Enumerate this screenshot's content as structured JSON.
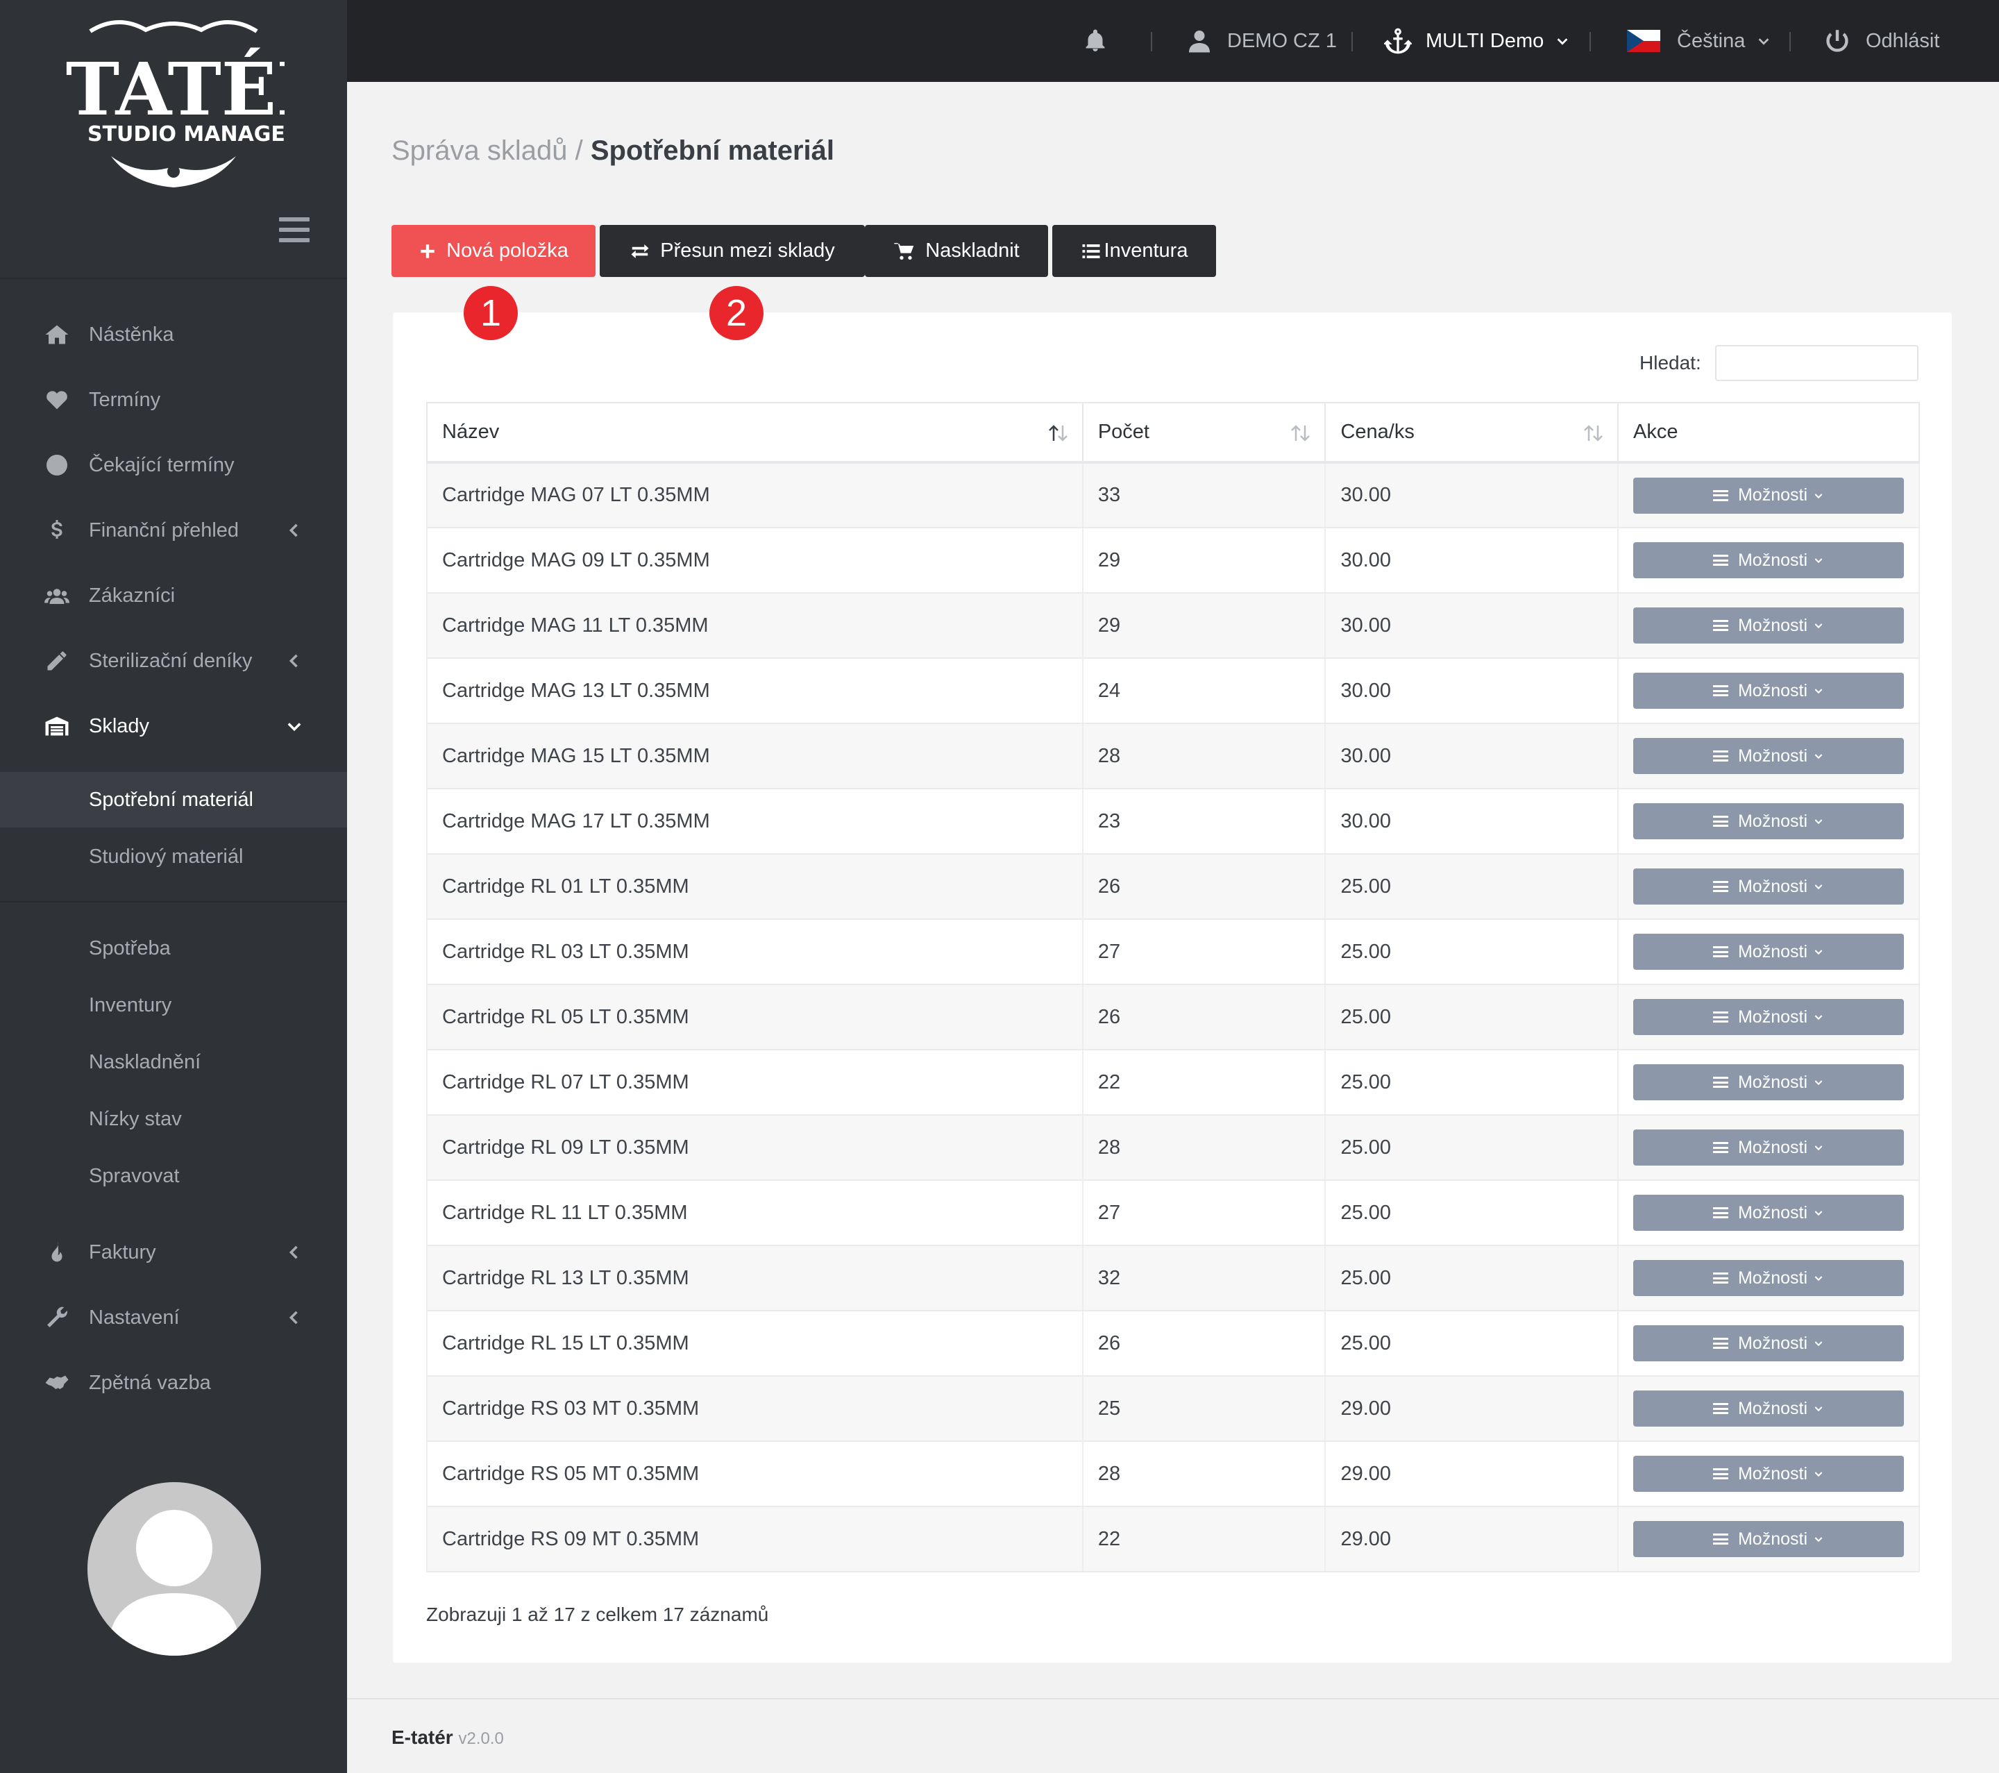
{
  "app": {
    "logo_text": "ETATÉR",
    "logo_sub": "STUDIO MANAGER"
  },
  "topbar": {
    "user": "DEMO CZ 1",
    "studio": "MULTI Demo",
    "language": "Čeština",
    "logout": "Odhlásit"
  },
  "sidebar": {
    "items": [
      {
        "label": "Nástěnka",
        "icon": "home-icon"
      },
      {
        "label": "Termíny",
        "icon": "heart-icon"
      },
      {
        "label": "Čekající termíny",
        "icon": "clock-icon"
      },
      {
        "label": "Finanční přehled",
        "icon": "dollar-icon"
      },
      {
        "label": "Zákazníci",
        "icon": "users-icon"
      },
      {
        "label": "Sterilizační deníky",
        "icon": "pencil-icon"
      },
      {
        "label": "Sklady",
        "icon": "warehouse-icon"
      },
      {
        "label": "Faktury",
        "icon": "fire-icon"
      },
      {
        "label": "Nastavení",
        "icon": "wrench-icon"
      },
      {
        "label": "Zpětná vazba",
        "icon": "handshake-icon"
      }
    ],
    "sub_items": [
      {
        "label": "Spotřební materiál"
      },
      {
        "label": "Studiový materiál"
      },
      {
        "label": "Spotřeba"
      },
      {
        "label": "Inventury"
      },
      {
        "label": "Naskladnění"
      },
      {
        "label": "Nízky stav"
      },
      {
        "label": "Spravovat"
      }
    ]
  },
  "breadcrumb": {
    "parent": "Správa skladů /",
    "current": "Spotřební materiál"
  },
  "toolbar": {
    "new_item": "Nová položka",
    "transfer": "Přesun mezi sklady",
    "restock": "Naskladnit",
    "inventory": "Inventura"
  },
  "markers": [
    "1",
    "2"
  ],
  "search": {
    "label": "Hledat:",
    "value": ""
  },
  "table": {
    "columns": [
      "Název",
      "Počet",
      "Cena/ks",
      "Akce"
    ],
    "action_label": "Možnosti",
    "rows": [
      {
        "name": "Cartridge MAG 07 LT 0.35MM",
        "count": "33",
        "price": "30.00"
      },
      {
        "name": "Cartridge MAG 09 LT 0.35MM",
        "count": "29",
        "price": "30.00"
      },
      {
        "name": "Cartridge MAG 11 LT 0.35MM",
        "count": "29",
        "price": "30.00"
      },
      {
        "name": "Cartridge MAG 13 LT 0.35MM",
        "count": "24",
        "price": "30.00"
      },
      {
        "name": "Cartridge MAG 15 LT 0.35MM",
        "count": "28",
        "price": "30.00"
      },
      {
        "name": "Cartridge MAG 17 LT 0.35MM",
        "count": "23",
        "price": "30.00"
      },
      {
        "name": "Cartridge RL 01 LT 0.35MM",
        "count": "26",
        "price": "25.00"
      },
      {
        "name": "Cartridge RL 03 LT 0.35MM",
        "count": "27",
        "price": "25.00"
      },
      {
        "name": "Cartridge RL 05 LT 0.35MM",
        "count": "26",
        "price": "25.00"
      },
      {
        "name": "Cartridge RL 07 LT 0.35MM",
        "count": "22",
        "price": "25.00"
      },
      {
        "name": "Cartridge RL 09 LT 0.35MM",
        "count": "28",
        "price": "25.00"
      },
      {
        "name": "Cartridge RL 11 LT 0.35MM",
        "count": "27",
        "price": "25.00"
      },
      {
        "name": "Cartridge RL 13 LT 0.35MM",
        "count": "32",
        "price": "25.00"
      },
      {
        "name": "Cartridge RL 15 LT 0.35MM",
        "count": "26",
        "price": "25.00"
      },
      {
        "name": "Cartridge RS 03 MT 0.35MM",
        "count": "25",
        "price": "29.00"
      },
      {
        "name": "Cartridge RS 05 MT 0.35MM",
        "count": "28",
        "price": "29.00"
      },
      {
        "name": "Cartridge RS 09 MT 0.35MM",
        "count": "22",
        "price": "29.00"
      }
    ]
  },
  "info": "Zobrazuji 1 až 17 z celkem 17 záznamů",
  "footer": {
    "brand": "E-tatér",
    "version": "v2.0.0"
  },
  "colors": {
    "accent": "#f05153",
    "sidebar": "#2f3338",
    "topbar": "#222427",
    "action_button": "#8c98aa",
    "marker": "#e8262b"
  }
}
